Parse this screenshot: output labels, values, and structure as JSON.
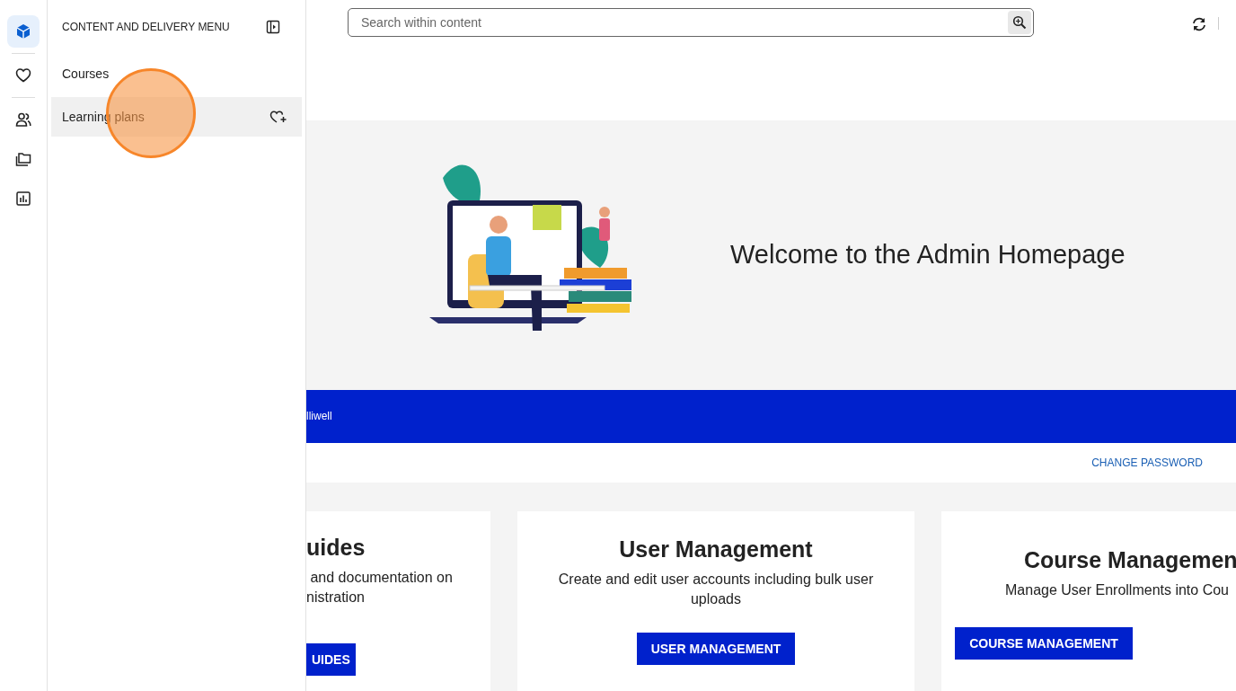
{
  "rail": {
    "items": [
      {
        "kind": "cube",
        "selected": true
      },
      {
        "kind": "heart",
        "selected": false
      },
      {
        "kind": "people",
        "selected": false
      },
      {
        "kind": "folders",
        "selected": false
      },
      {
        "kind": "chart",
        "selected": false
      }
    ]
  },
  "menu": {
    "title": "CONTENT AND DELIVERY MENU",
    "items": [
      {
        "label": "Courses",
        "selected": false
      },
      {
        "label": "Learning plans",
        "selected": true
      }
    ]
  },
  "header": {
    "search": {
      "placeholder": "Search within content"
    }
  },
  "banner": {
    "title": "Welcome to the Admin Homepage"
  },
  "user_bar": {
    "text": "lliwell"
  },
  "links": [
    "CHANGE PASSWORD"
  ],
  "cards": [
    {
      "title": "uides",
      "lines": [
        " and documentation on",
        "nistration"
      ],
      "button": "UIDES",
      "kind": "cut_left"
    },
    {
      "title": "User Management",
      "lines": [
        "Create and edit user accounts including bulk user uploads"
      ],
      "button": "USER MANAGEMENT",
      "kind": "full"
    },
    {
      "title": "Course Managemen",
      "lines": [
        "Manage User Enrollments into Cou"
      ],
      "button": "COURSE MANAGEMENT",
      "kind": "cut_right"
    }
  ]
}
